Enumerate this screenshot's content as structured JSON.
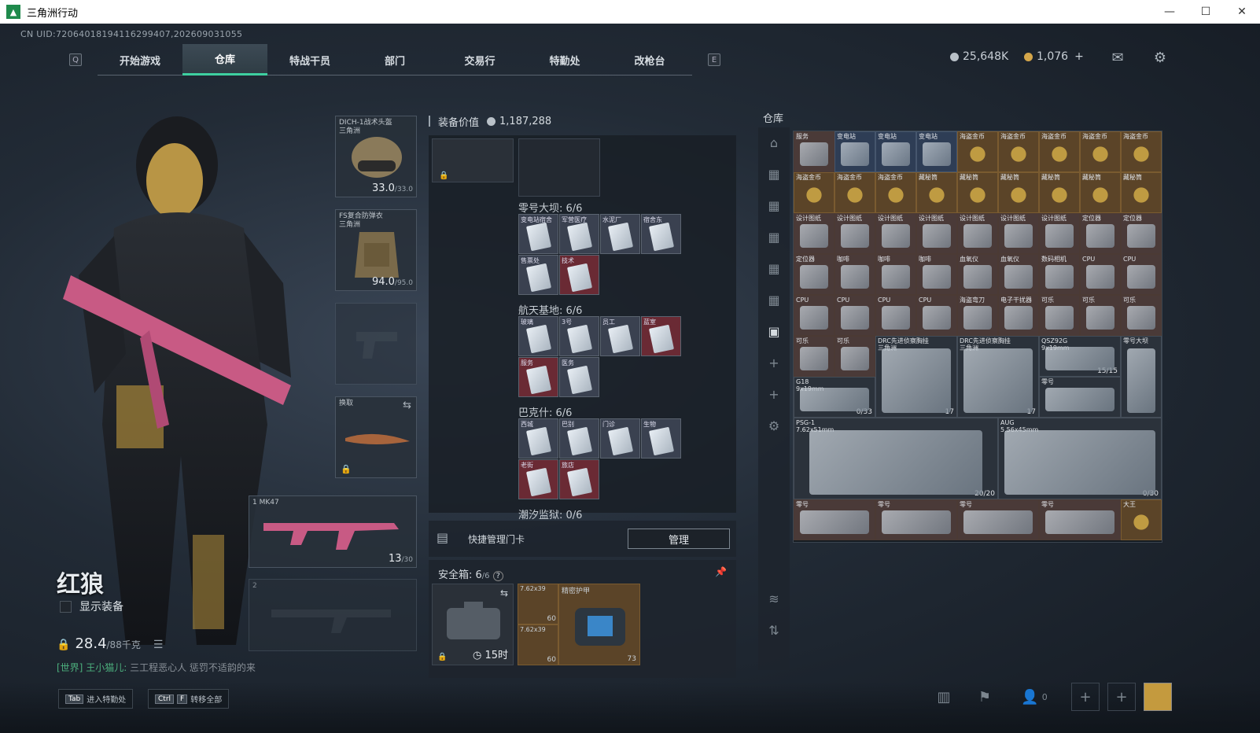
{
  "window": {
    "title": "三角洲行动",
    "minimize": "—",
    "maximize": "☐",
    "close": "✕"
  },
  "uid": "CN UID:7206401819411629940​7,202609031055",
  "nav": {
    "left_key": "Q",
    "right_key": "E",
    "tabs": [
      "开始游戏",
      "仓库",
      "特战干员",
      "部门",
      "交易行",
      "特勤处",
      "改枪台"
    ],
    "active": "仓库",
    "badge": "!"
  },
  "currency": {
    "silver": "25,648K",
    "gold": "1,076",
    "plus": "+"
  },
  "character": {
    "name": "红狼",
    "show_gear": "显示装备",
    "weight": "28.4",
    "weight_max": "/88千克"
  },
  "chat": {
    "channel": "[世界]",
    "user": "王小猫儿:",
    "message": "三工程恶心人 惩罚不适韵的来"
  },
  "equipment": {
    "helmet": {
      "label": "DICH-1战术头盔",
      "sub": "三角洲",
      "durability": "33.0",
      "max": "/33.0"
    },
    "armor": {
      "label": "FS复合防弹衣",
      "sub": "三角洲",
      "durability": "94.0",
      "max": "/95.0"
    },
    "melee": {
      "label": "换取"
    },
    "weapon1": {
      "slot": "1",
      "name": "MK47",
      "ammo": "13",
      "ammo_max": "/30"
    },
    "weapon2": {
      "slot": "2"
    }
  },
  "middle": {
    "equip_value_label": "装备价值",
    "equip_value": "1,187,288",
    "sections": [
      {
        "title": "零号大坝: 6/6",
        "cards": [
          "变电站宿舍",
          "军营医疗",
          "水泥厂",
          "宿舍东",
          "售票处",
          "技术"
        ]
      },
      {
        "title": "航天基地: 6/6",
        "cards": [
          "玻璃",
          "3号",
          "员工",
          "蓝室",
          "服务",
          "医务"
        ]
      },
      {
        "title": "巴克什: 6/6",
        "cards": [
          "西城",
          "巴别",
          "门诊",
          "生物",
          "老街",
          "旅店"
        ]
      },
      {
        "title": "潮汐监狱: 0/6",
        "cards": []
      }
    ],
    "quick_manage": "快捷管理门卡",
    "manage_button": "管理",
    "safe_title": "安全箱: 6",
    "safe_cap": "/6",
    "safe_timer": "15时",
    "safe_items": [
      {
        "label": "7.62x39",
        "count": "60"
      },
      {
        "label": "7.62x39",
        "count": "60"
      },
      {
        "label": "精密护甲",
        "count": "73"
      }
    ]
  },
  "warehouse": {
    "title": "仓库",
    "rows": [
      [
        {
          "l": "服务",
          "c": "red"
        },
        {
          "l": "变电站",
          "c": "blue"
        },
        {
          "l": "变电站",
          "c": "blue"
        },
        {
          "l": "变电站",
          "c": "blue"
        },
        {
          "l": "海盗金币",
          "c": "gold"
        },
        {
          "l": "海盗金币",
          "c": "gold"
        },
        {
          "l": "海盗金币",
          "c": "gold"
        },
        {
          "l": "海盗金币",
          "c": "gold"
        },
        {
          "l": "海盗金币",
          "c": "gold"
        }
      ],
      [
        {
          "l": "海盗金币",
          "c": "gold"
        },
        {
          "l": "海盗金币",
          "c": "gold"
        },
        {
          "l": "海盗金币",
          "c": "gold"
        },
        {
          "l": "藏秘筒",
          "c": "gold"
        },
        {
          "l": "藏秘筒",
          "c": "gold"
        },
        {
          "l": "藏秘筒",
          "c": "gold"
        },
        {
          "l": "藏秘筒",
          "c": "gold"
        },
        {
          "l": "藏秘筒",
          "c": "gold"
        },
        {
          "l": "藏秘筒",
          "c": "gold"
        }
      ],
      [
        {
          "l": "设计图纸",
          "c": "red"
        },
        {
          "l": "设计图纸",
          "c": "red"
        },
        {
          "l": "设计图纸",
          "c": "red"
        },
        {
          "l": "设计图纸",
          "c": "red"
        },
        {
          "l": "设计图纸",
          "c": "red"
        },
        {
          "l": "设计图纸",
          "c": "red"
        },
        {
          "l": "设计图纸",
          "c": "red"
        },
        {
          "l": "定位器",
          "c": "red"
        },
        {
          "l": "定位器",
          "c": "red"
        }
      ],
      [
        {
          "l": "定位器",
          "c": "red"
        },
        {
          "l": "咖啡",
          "c": "red"
        },
        {
          "l": "咖啡",
          "c": "red"
        },
        {
          "l": "咖啡",
          "c": "red"
        },
        {
          "l": "血氧仪",
          "c": "red"
        },
        {
          "l": "血氧仪",
          "c": "red"
        },
        {
          "l": "数码相机",
          "c": "red"
        },
        {
          "l": "CPU",
          "c": "red"
        },
        {
          "l": "CPU",
          "c": "red"
        }
      ],
      [
        {
          "l": "CPU",
          "c": "red"
        },
        {
          "l": "CPU",
          "c": "red"
        },
        {
          "l": "CPU",
          "c": "red"
        },
        {
          "l": "CPU",
          "c": "red"
        },
        {
          "l": "海盗弯刀",
          "c": "red"
        },
        {
          "l": "电子干扰器",
          "c": "red"
        },
        {
          "l": "可乐",
          "c": "red"
        },
        {
          "l": "可乐",
          "c": "red"
        },
        {
          "l": "可乐",
          "c": "red"
        }
      ]
    ],
    "row6": [
      {
        "l": "可乐"
      },
      {
        "l": "可乐"
      },
      {
        "l": "DRC先进侦察胸挂",
        "sub": "三角洲",
        "n": "17"
      },
      {
        "l": "DRC先进侦察胸挂",
        "sub": "三角洲",
        "n": "17"
      },
      {
        "l": "QSZ92G",
        "sub": "9x19mm",
        "n": "15/15"
      },
      {
        "l": "零号大坝"
      }
    ],
    "row7": [
      {
        "l": "G18",
        "sub": "9x19mm",
        "n": "0/33"
      },
      {
        "l": "零号"
      }
    ],
    "row8": [
      {
        "l": "PSG-1",
        "sub": "7.62x51mm",
        "n": "20/20"
      },
      {
        "l": "AUG",
        "sub": "5.56x45mm",
        "n": "0/30"
      }
    ],
    "row9": [
      {
        "l": "零号"
      },
      {
        "l": "零号"
      },
      {
        "l": "零号"
      },
      {
        "l": "零号"
      },
      {
        "l": "大王"
      }
    ]
  },
  "bottom": {
    "tab_key": "Tab",
    "tab_label": "进入特勤处",
    "ctrl_key": "Ctrl",
    "f_key": "F",
    "transfer_label": "转移全部",
    "team_count": "0"
  }
}
